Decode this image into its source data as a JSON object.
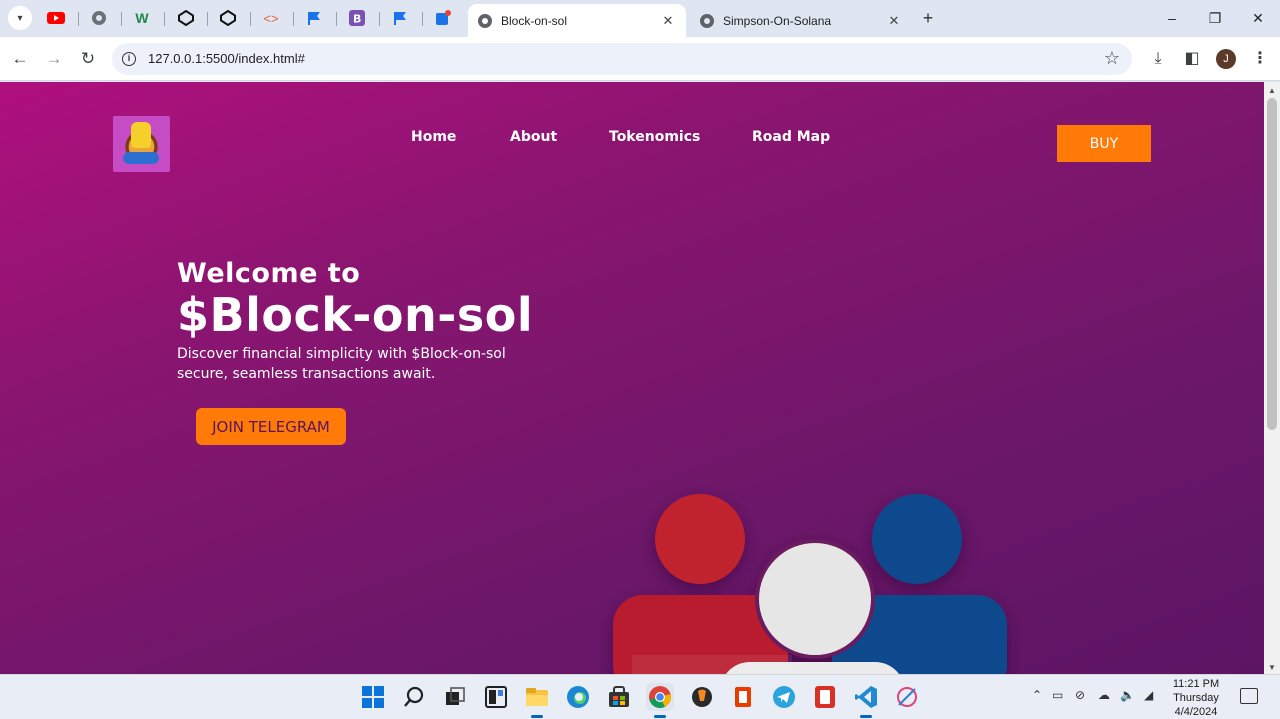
{
  "browser": {
    "tabs": [
      {
        "title": "Block-on-sol",
        "active": true
      },
      {
        "title": "Simpson-On-Solana",
        "active": false
      }
    ],
    "pinned_icons": [
      "youtube-icon",
      "globe-icon",
      "webflow-icon",
      "codepen-icon",
      "codepen-icon",
      "code-icon",
      "flag-icon",
      "bootstrap-icon",
      "flag-icon",
      "edit-icon"
    ],
    "url": "127.0.0.1:5500/index.html#",
    "profile_initial": "J"
  },
  "site": {
    "nav": {
      "home": "Home",
      "about": "About",
      "tokenomics": "Tokenomics",
      "roadmap": "Road Map"
    },
    "buy_label": "BUY",
    "hero": {
      "welcome": "Welcome to",
      "token": "$Block-on-sol",
      "subtitle": "Discover financial simplicity with $Block-on-sol secure, seamless transactions await.",
      "cta": "JOIN TELEGRAM"
    },
    "colors": {
      "accent": "#ff7a06",
      "background_start": "#b0107e",
      "background_end": "#5c1564"
    }
  },
  "taskbar": {
    "apps": [
      "windows-start-icon",
      "search-icon",
      "task-view-icon",
      "widgets-icon",
      "file-explorer-icon",
      "edge-icon",
      "store-icon",
      "chrome-icon",
      "fl-studio-icon",
      "office-icon",
      "telegram-icon",
      "pdf-reader-icon",
      "vscode-icon",
      "snipping-tool-icon"
    ],
    "time": "11:21 PM",
    "day": "Thursday",
    "date": "4/4/2024"
  }
}
